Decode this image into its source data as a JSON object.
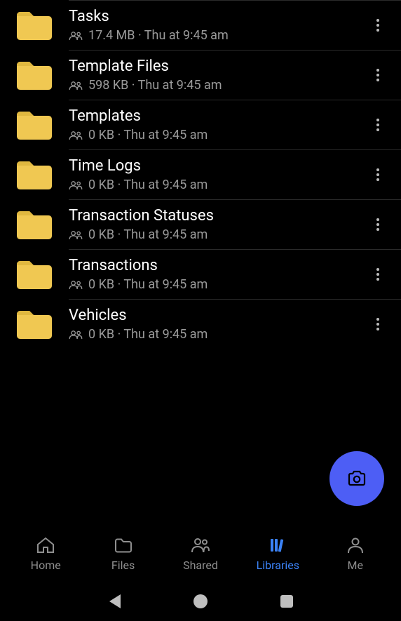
{
  "folders": [
    {
      "name": "Tasks",
      "size": "17.4 MB",
      "timestamp": "Thu at 9:45 am"
    },
    {
      "name": "Template Files",
      "size": "598 KB",
      "timestamp": "Thu at 9:45 am"
    },
    {
      "name": "Templates",
      "size": "0 KB",
      "timestamp": "Thu at 9:45 am"
    },
    {
      "name": "Time Logs",
      "size": "0 KB",
      "timestamp": "Thu at 9:45 am"
    },
    {
      "name": "Transaction Statuses",
      "size": "0 KB",
      "timestamp": "Thu at 9:45 am"
    },
    {
      "name": "Transactions",
      "size": "0 KB",
      "timestamp": "Thu at 9:45 am"
    },
    {
      "name": "Vehicles",
      "size": "0 KB",
      "timestamp": "Thu at 9:45 am"
    }
  ],
  "tabs": {
    "home": "Home",
    "files": "Files",
    "shared": "Shared",
    "libraries": "Libraries",
    "me": "Me",
    "active": "libraries"
  },
  "separator": "·"
}
